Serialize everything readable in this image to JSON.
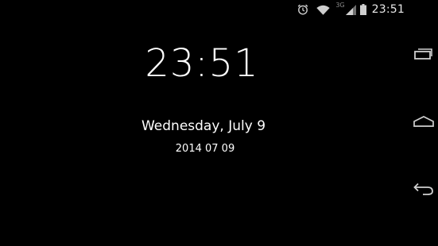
{
  "status_bar": {
    "icons": [
      "alarm-icon",
      "wifi-icon",
      "signal-icon",
      "battery-icon"
    ],
    "network_type": "3G",
    "time": "23:51"
  },
  "lockscreen": {
    "time": "23:51",
    "date_long": "Wednesday, July 9",
    "date_short": "2014 07 09"
  },
  "nav_bar": {
    "buttons": [
      "recents-icon",
      "home-icon",
      "back-icon"
    ]
  },
  "colors": {
    "background": "#000000",
    "text": "#ffffff",
    "icons": "#cfcfcf",
    "dim": "#8a8a8a"
  }
}
